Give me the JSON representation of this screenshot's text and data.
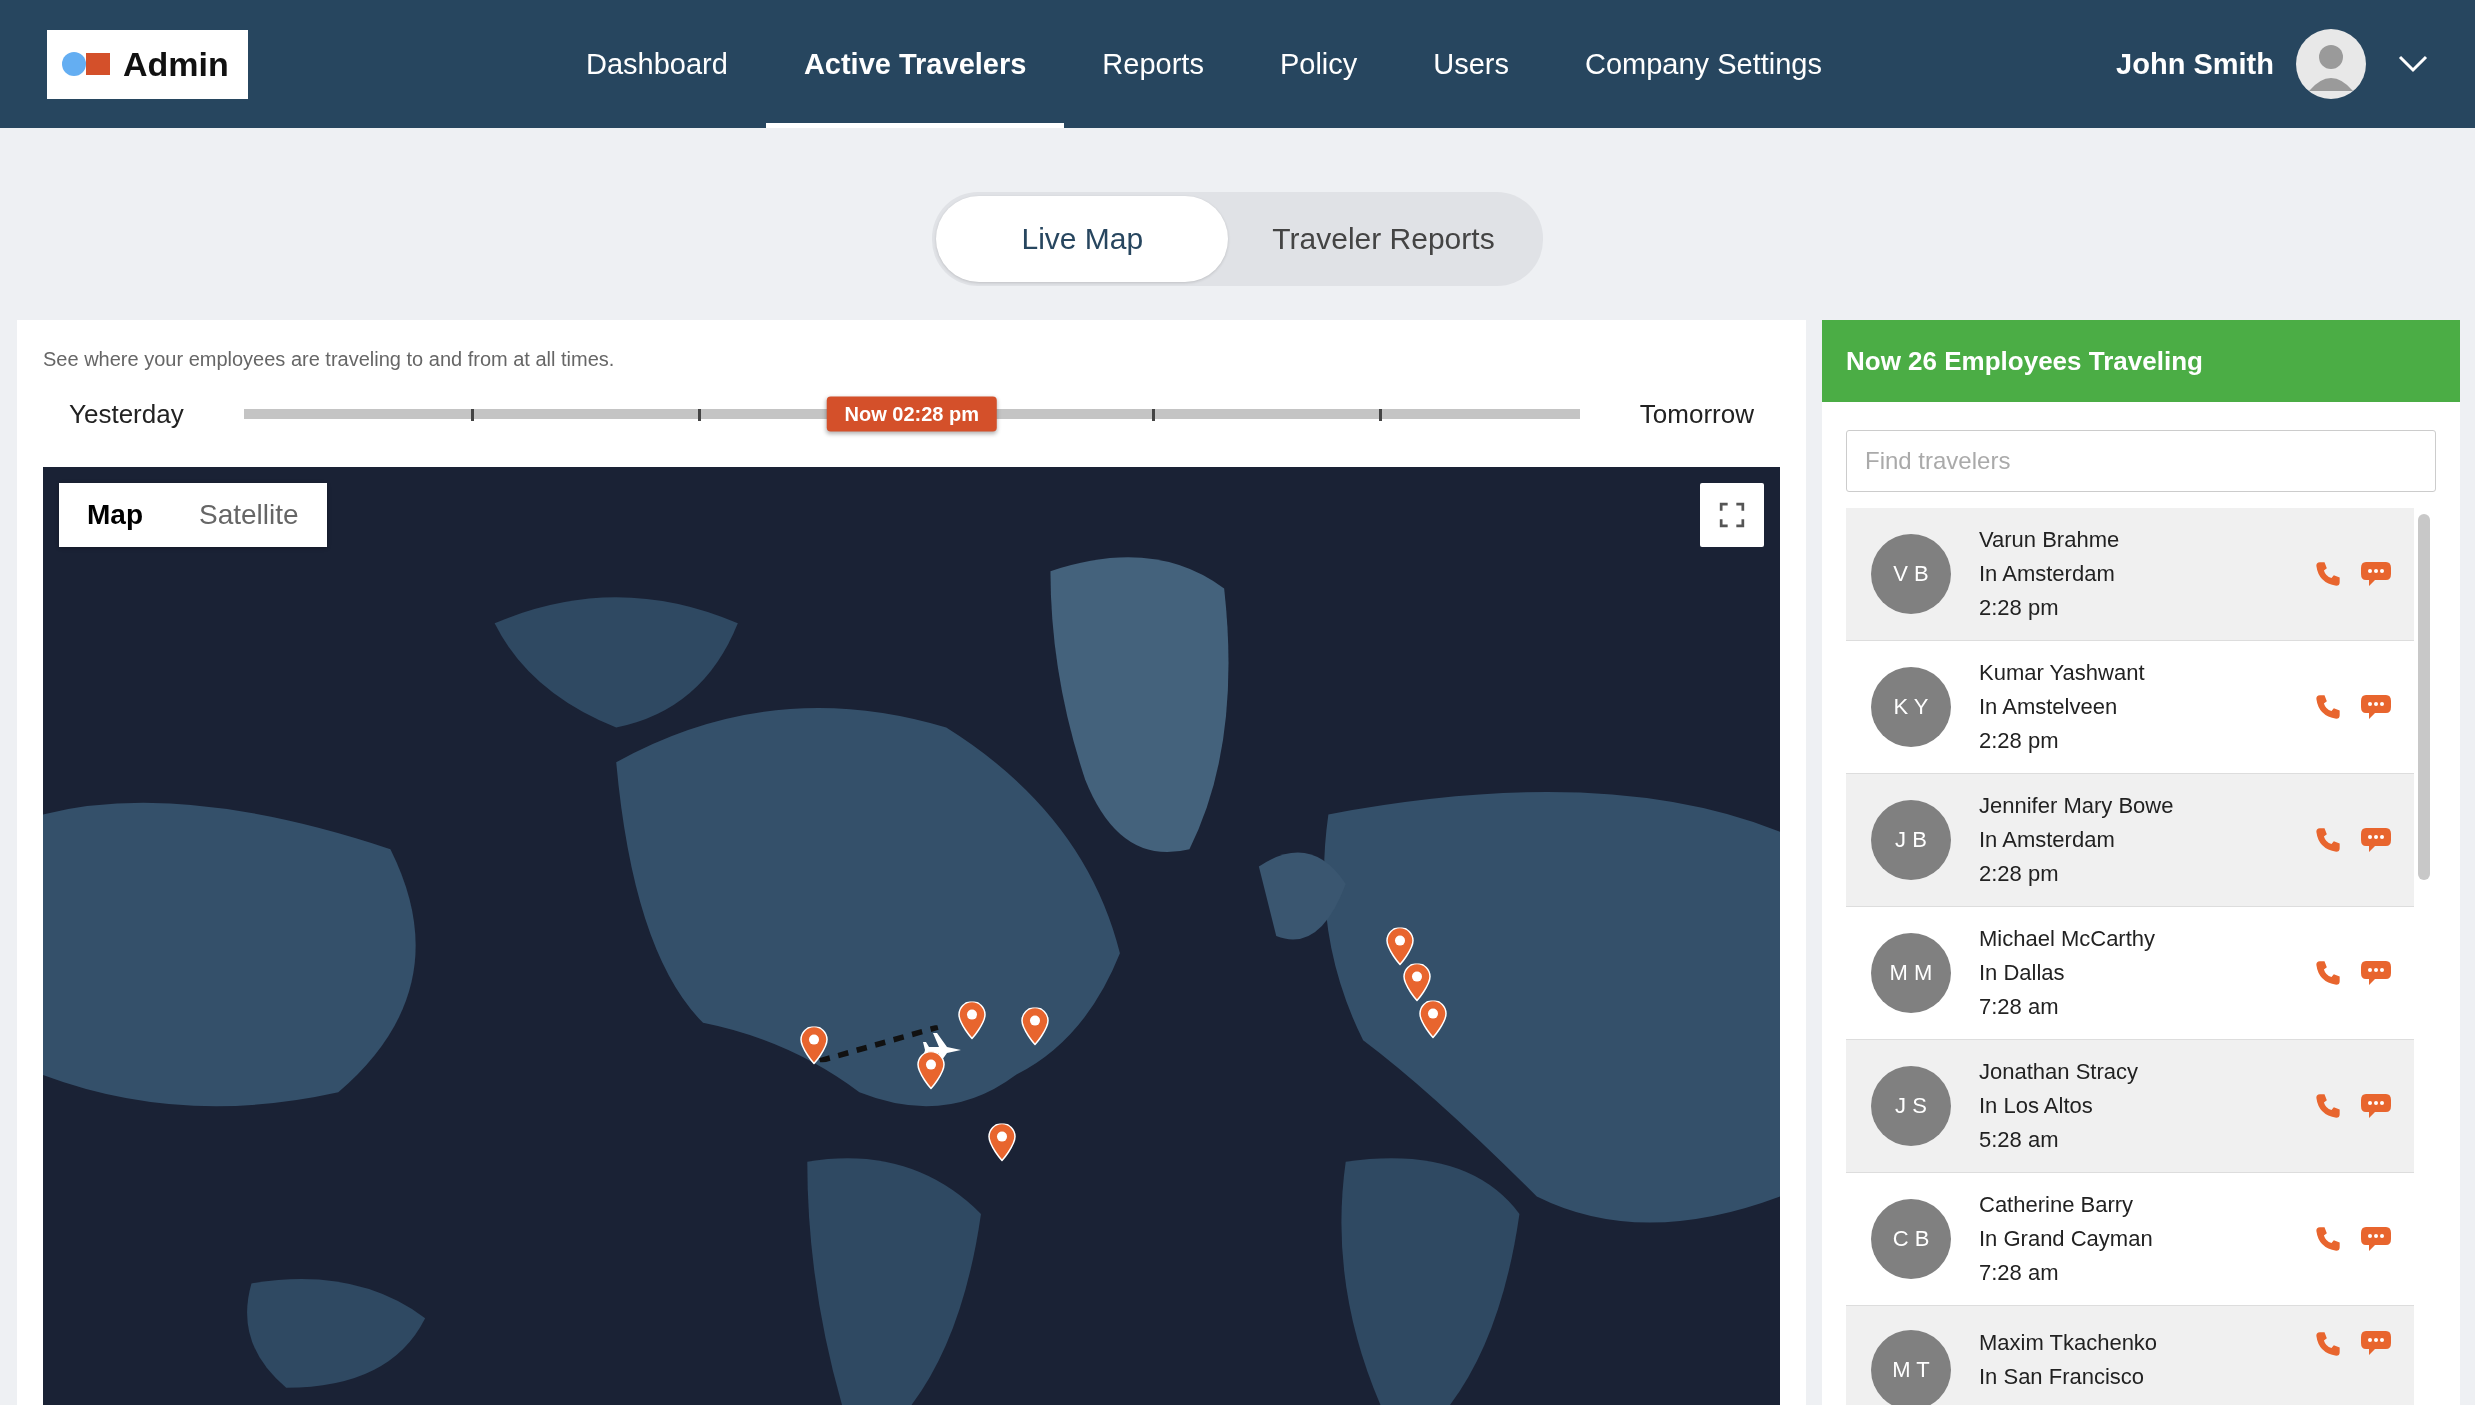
{
  "header": {
    "logo": "Admin",
    "nav": [
      {
        "label": "Dashboard",
        "selected": false
      },
      {
        "label": "Active Travelers",
        "selected": true
      },
      {
        "label": "Reports",
        "selected": false
      },
      {
        "label": "Policy",
        "selected": false
      },
      {
        "label": "Users",
        "selected": false
      },
      {
        "label": "Company Settings",
        "selected": false
      }
    ],
    "user_name": "John Smith"
  },
  "view_tabs": [
    {
      "label": "Live Map",
      "selected": true
    },
    {
      "label": "Traveler Reports",
      "selected": false
    }
  ],
  "map_panel": {
    "description": "See where your employees are traveling to and from at all times.",
    "timeline": {
      "start": "Yesterday",
      "end": "Tomorrow",
      "marker": "Now 02:28 pm",
      "level": 0.5
    },
    "map_types": [
      {
        "label": "Map",
        "selected": true
      },
      {
        "label": "Satellite",
        "selected": false
      }
    ]
  },
  "travelers_panel": {
    "title": "Now 26 Employees Traveling",
    "search": {
      "placeholder": "Find travelers"
    },
    "travelers": [
      {
        "initials": "V B",
        "name": "Varun Brahme",
        "location": "In Amsterdam",
        "time": "2:28 pm"
      },
      {
        "initials": "K Y",
        "name": "Kumar Yashwant",
        "location": "In Amstelveen",
        "time": "2:28 pm"
      },
      {
        "initials": "J B",
        "name": "Jennifer Mary Bowe",
        "location": "In Amsterdam",
        "time": "2:28 pm"
      },
      {
        "initials": "M M",
        "name": "Michael McCarthy",
        "location": "In Dallas",
        "time": "7:28 am"
      },
      {
        "initials": "J S",
        "name": "Jonathan Stracy",
        "location": "In Los Altos",
        "time": "5:28 am"
      },
      {
        "initials": "C B",
        "name": "Catherine Barry",
        "location": "In Grand Cayman",
        "time": "7:28 am"
      },
      {
        "initials": "M T",
        "name": "Maxim Tkachenko",
        "location": "In San Francisco"
      }
    ]
  }
}
